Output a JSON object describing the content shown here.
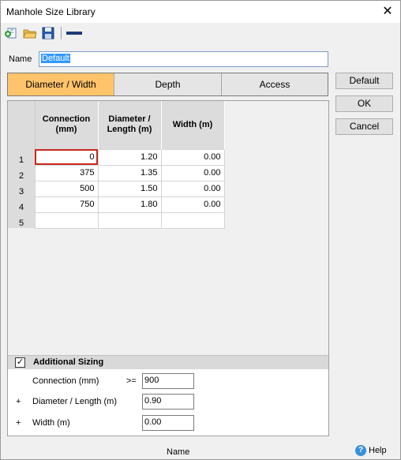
{
  "window": {
    "title": "Manhole Size Library"
  },
  "name_field": {
    "label": "Name",
    "value": "Default"
  },
  "tabs": [
    {
      "label": "Diameter / Width",
      "active": true
    },
    {
      "label": "Depth",
      "active": false
    },
    {
      "label": "Access",
      "active": false
    }
  ],
  "side_buttons": {
    "default": "Default",
    "ok": "OK",
    "cancel": "Cancel"
  },
  "grid": {
    "headers": [
      "Connection\n(mm)",
      "Diameter /\nLength (m)",
      "Width (m)"
    ],
    "rows": [
      {
        "num": "1",
        "connection": "0",
        "diameter": "1.20",
        "width": "0.00"
      },
      {
        "num": "2",
        "connection": "375",
        "diameter": "1.35",
        "width": "0.00"
      },
      {
        "num": "3",
        "connection": "500",
        "diameter": "1.50",
        "width": "0.00"
      },
      {
        "num": "4",
        "connection": "750",
        "diameter": "1.80",
        "width": "0.00"
      },
      {
        "num": "5",
        "connection": "",
        "diameter": "",
        "width": ""
      }
    ]
  },
  "additional_sizing": {
    "checked": true,
    "check_mark": "✓",
    "label": "Additional Sizing",
    "connection": {
      "label": "Connection (mm)",
      "operator": ">=",
      "value": "900"
    },
    "diameter": {
      "prefix": "+",
      "label": "Diameter / Length (m)",
      "value": "0.90"
    },
    "width": {
      "prefix": "+",
      "label": "Width (m)",
      "value": "0.00"
    }
  },
  "status": {
    "name": "Name",
    "help": "Help"
  },
  "icons": {
    "close": "close-icon",
    "new": "new-icon",
    "open": "open-folder-icon",
    "save": "save-icon",
    "line": "line-icon",
    "help": "help-icon"
  },
  "colors": {
    "active_tab": "#ffc36b",
    "focus_cell": "#c8281e",
    "selection": "#3399ff"
  }
}
